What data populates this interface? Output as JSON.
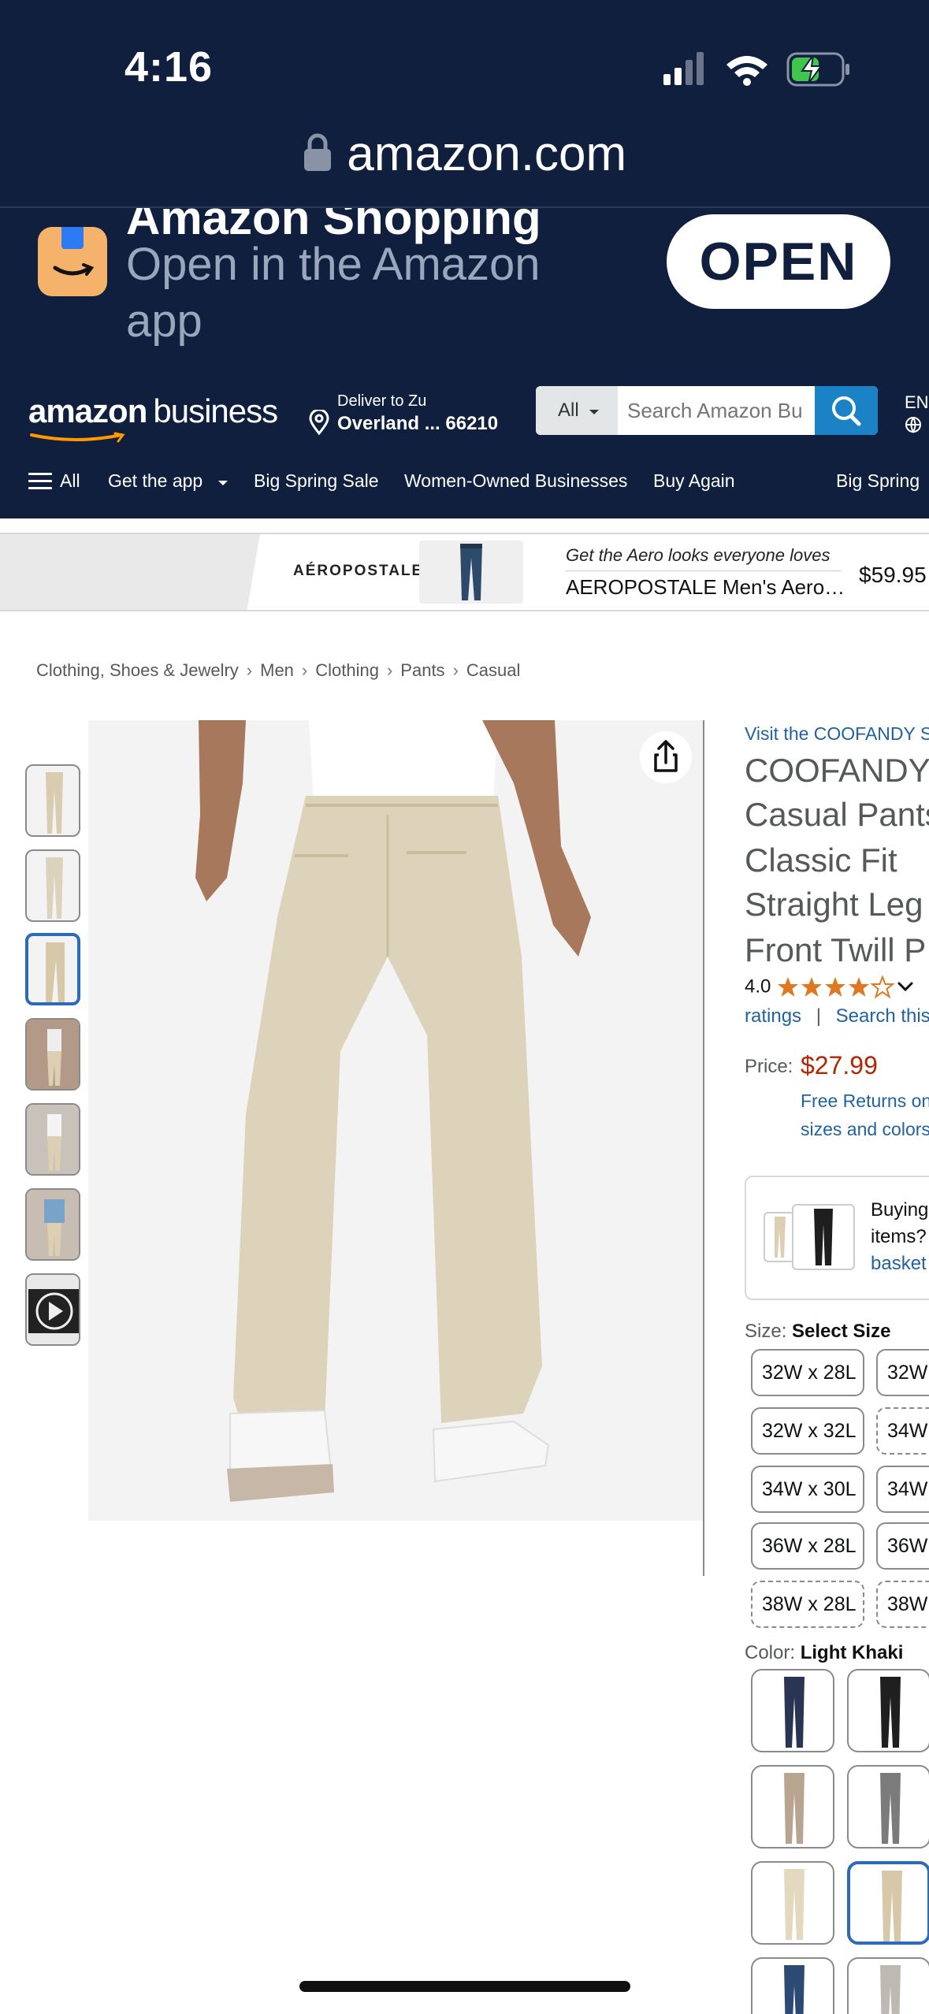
{
  "status_bar": {
    "time": "4:16"
  },
  "browser": {
    "url": "amazon.com"
  },
  "app_banner": {
    "name": "Amazon Shopping",
    "subtitle": "Open in the Amazon app",
    "open_label": "OPEN"
  },
  "header": {
    "logo_main": "amazon",
    "logo_sub": "business",
    "deliver_line1": "Deliver to Zu",
    "deliver_line2": "Overland ... 66210",
    "search_category": "All",
    "search_placeholder": "Search Amazon Bu",
    "language": "EN"
  },
  "nav": {
    "all": "All",
    "items": [
      "Get the app",
      "Big Spring Sale",
      "Women-Owned Businesses",
      "Buy Again",
      "Big Spring"
    ]
  },
  "ad": {
    "brand": "AÉROPOSTALE",
    "tagline": "Get the Aero looks everyone loves",
    "title": "AEROPOSTALE Men's Aero…",
    "price": "$59.95"
  },
  "breadcrumb": [
    "Clothing, Shoes & Jewelry",
    "Men",
    "Clothing",
    "Pants",
    "Casual"
  ],
  "product": {
    "store_link": "Visit the COOFANDY S",
    "title_lines": [
      "COOFANDY",
      "Casual Pants",
      "Classic Fit",
      "Straight Leg",
      "Front Twill P"
    ],
    "rating": "4.0",
    "stars": 4,
    "ratings_link": "ratings",
    "search_link": "Search this",
    "price_label": "Price:",
    "price": "$27.99",
    "returns_line1": "Free Returns on",
    "returns_line2": "sizes and colors",
    "basket_line1": "Buying",
    "basket_line2": "items?",
    "basket_line3": "basket",
    "size_label": "Size:",
    "size_value": "Select Size",
    "sizes": [
      "32W x 28L",
      "32W",
      "32W x 32L",
      "34W",
      "34W x 30L",
      "34W",
      "36W x 28L",
      "36W",
      "38W x 28L",
      "38W"
    ],
    "color_label": "Color:",
    "color_value": "Light Khaki"
  },
  "colors": {
    "brand_navy": "#0f1f3d",
    "link": "#2162a1",
    "price": "#b12704",
    "star": "#de7921",
    "selected": "#2d6bb8"
  }
}
